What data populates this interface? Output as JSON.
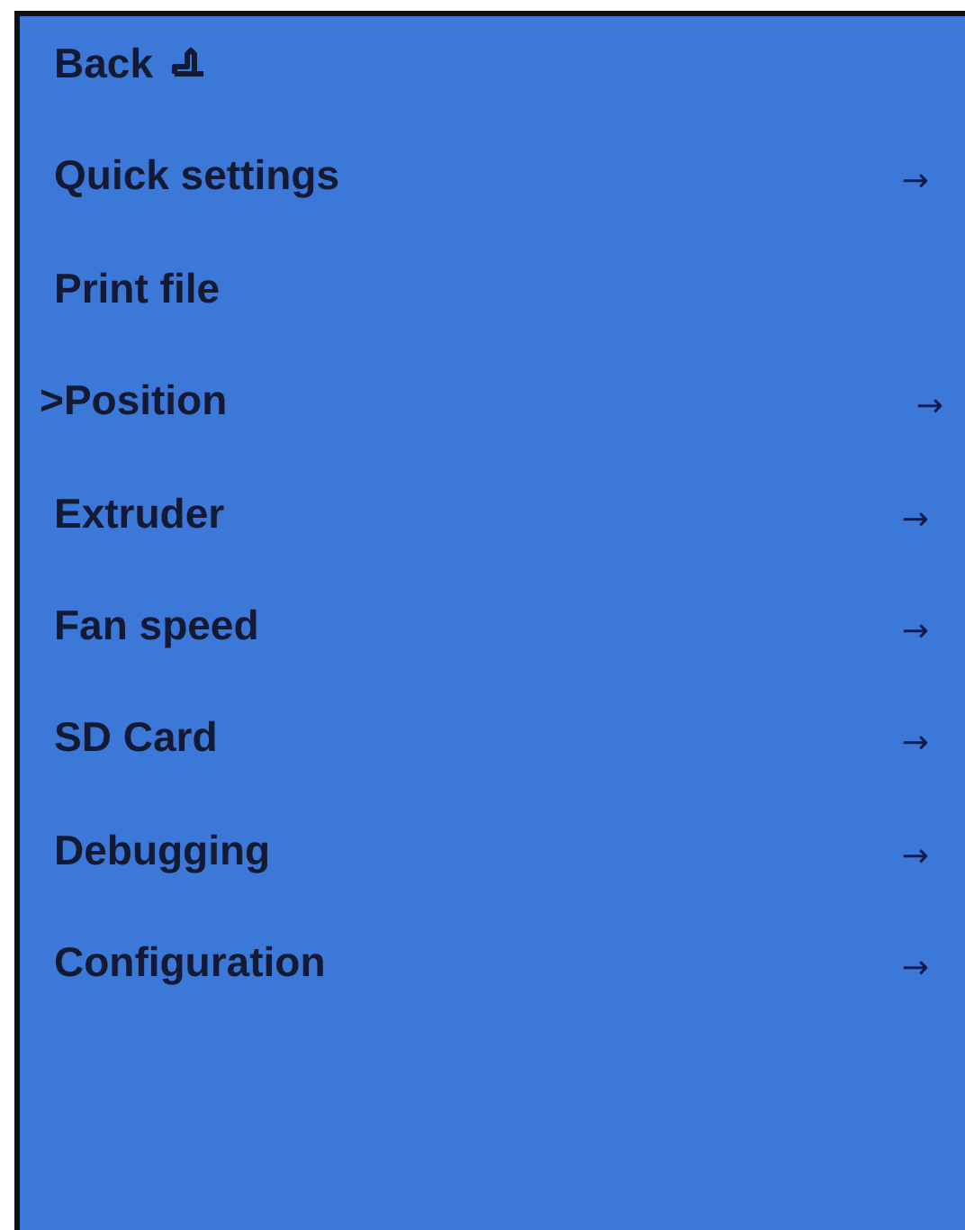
{
  "menu": {
    "items": [
      {
        "kind": "back",
        "label": "Back"
      },
      {
        "kind": "submenu",
        "label": "Quick settings",
        "arrow": "→"
      },
      {
        "kind": "action",
        "label": "Print file"
      },
      {
        "kind": "submenu",
        "cursor": ">",
        "label": "Position",
        "arrow": "→"
      },
      {
        "kind": "submenu",
        "label": "Extruder",
        "arrow": "→"
      },
      {
        "kind": "submenu",
        "label": "Fan speed",
        "arrow": "→"
      },
      {
        "kind": "submenu",
        "label": "SD Card",
        "arrow": "→"
      },
      {
        "kind": "submenu",
        "label": "Debugging",
        "arrow": "→"
      },
      {
        "kind": "submenu",
        "label": "Configuration",
        "arrow": "→"
      }
    ]
  }
}
